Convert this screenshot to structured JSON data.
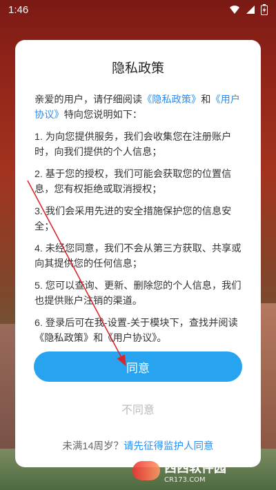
{
  "status_bar": {
    "time": "1:46",
    "icons": [
      "wifi-icon",
      "signal-icon",
      "battery-charging-icon"
    ]
  },
  "dialog": {
    "title": "隐私政策",
    "intro": {
      "prefix": "亲爱的用户，请仔细阅读",
      "policy_link": "《隐私政策》",
      "and": "和",
      "agreement_link": "《用户协议》",
      "suffix": "特向您说明如下："
    },
    "items": [
      "1. 为向您提供服务，我们会收集您在注册账户时，向我们提供的个人信息；",
      "2. 基于您的授权，我们可能会获取您的位置信息，您有权拒绝或取消授权；",
      "3. 我们会采用先进的安全措施保护您的信息安全；",
      "4. 未经您同意，我们不会从第三方获取、共享或向其提供您的任何信息；",
      "5. 您可以查询、更新、删除您的个人信息，我们也提供账户注销的渠道。",
      "6. 登录后可在我-设置-关于模块下，查找并阅读《隐私政策》和《用户协议》。"
    ],
    "agree_label": "同意",
    "disagree_label": "不同意",
    "minor_notice": {
      "text": "未满14周岁？",
      "link": "请先征得监护人同意"
    }
  },
  "watermark": {
    "brand": "西西软件园",
    "domain": "CR173.COM"
  },
  "colors": {
    "accent": "#27a3f0",
    "link": "#2b8ef0",
    "arrow": "#d9262b"
  }
}
